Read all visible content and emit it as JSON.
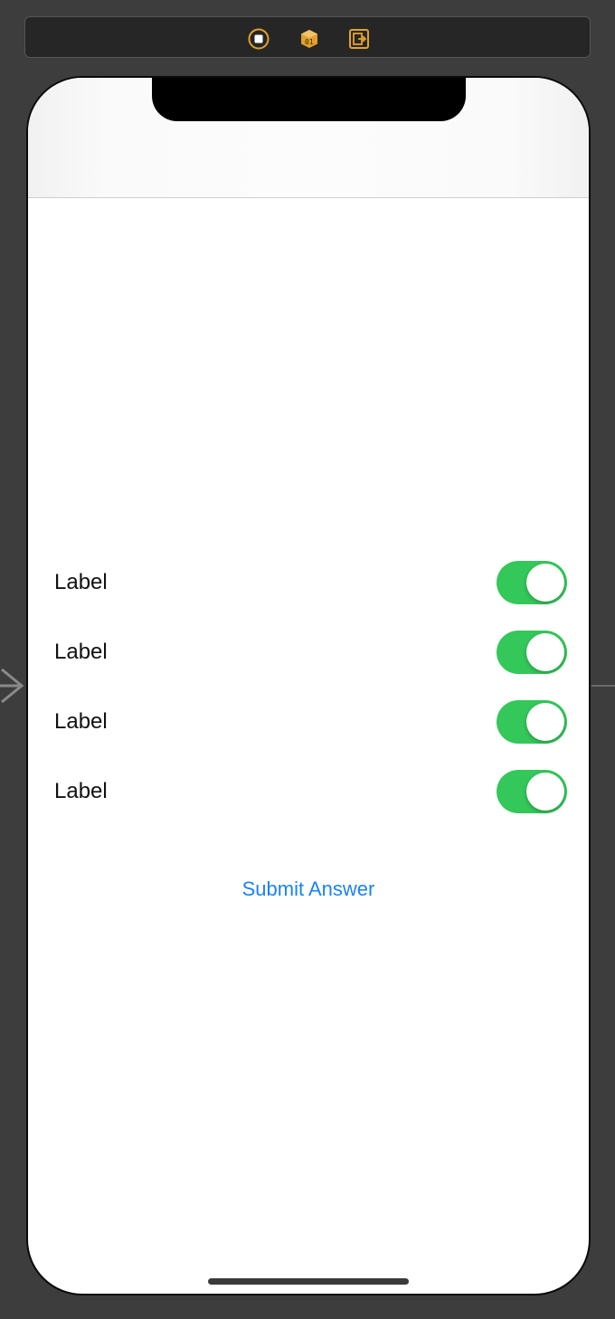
{
  "scene_dock": {
    "icons": [
      "view-controller-icon",
      "first-responder-icon",
      "exit-icon"
    ],
    "accent": "#e2a12c"
  },
  "rows": [
    {
      "label": "Label",
      "switch_on": true
    },
    {
      "label": "Label",
      "switch_on": true
    },
    {
      "label": "Label",
      "switch_on": true
    },
    {
      "label": "Label",
      "switch_on": true
    }
  ],
  "submit_button": {
    "label": "Submit Answer"
  },
  "colors": {
    "switch_on": "#34c759",
    "link": "#1a82f7",
    "canvas": "#3d3d3d"
  }
}
